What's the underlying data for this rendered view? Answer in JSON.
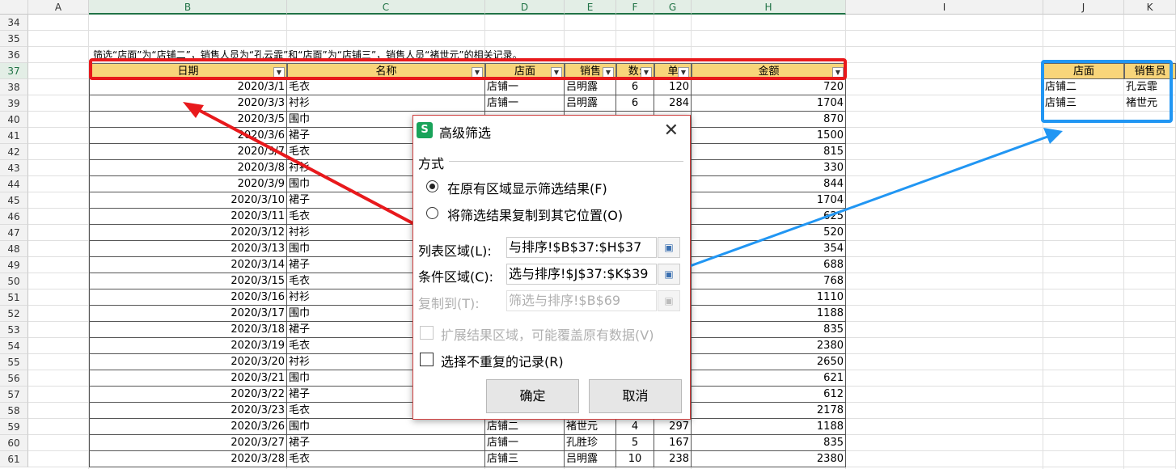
{
  "columns": [
    {
      "letter": "A"
    },
    {
      "letter": "B"
    },
    {
      "letter": "C"
    },
    {
      "letter": "D"
    },
    {
      "letter": "E"
    },
    {
      "letter": "F"
    },
    {
      "letter": "G"
    },
    {
      "letter": "H"
    },
    {
      "letter": "I"
    },
    {
      "letter": "J"
    },
    {
      "letter": "K"
    }
  ],
  "row_numbers": [
    "34",
    "35",
    "36",
    "37",
    "38",
    "39",
    "40",
    "41",
    "42",
    "43",
    "44",
    "45",
    "46",
    "47",
    "48",
    "49",
    "50",
    "51",
    "52",
    "53",
    "54",
    "55",
    "56",
    "57",
    "58",
    "59",
    "60",
    "61"
  ],
  "instruction": "筛选“店面”为“店铺二”，销售人员为“孔云霏”和“店面”为“店铺三”，销售人员“褚世元”的相关记录。",
  "table_headers": [
    "日期",
    "名称",
    "店面",
    "销售",
    "数:",
    "单",
    "金额"
  ],
  "table_rows": [
    [
      "2020/3/1",
      "毛衣",
      "店铺一",
      "吕明露",
      "6",
      "120",
      "720"
    ],
    [
      "2020/3/3",
      "衬衫",
      "店铺一",
      "吕明露",
      "6",
      "284",
      "1704"
    ],
    [
      "2020/3/5",
      "围巾",
      "",
      "",
      "",
      "",
      "870"
    ],
    [
      "2020/3/6",
      "裙子",
      "",
      "",
      "",
      "",
      "1500"
    ],
    [
      "2020/3/7",
      "毛衣",
      "",
      "",
      "",
      "",
      "815"
    ],
    [
      "2020/3/8",
      "衬衫",
      "",
      "",
      "",
      "",
      "330"
    ],
    [
      "2020/3/9",
      "围巾",
      "",
      "",
      "",
      "",
      "844"
    ],
    [
      "2020/3/10",
      "裙子",
      "",
      "",
      "",
      "",
      "1704"
    ],
    [
      "2020/3/11",
      "毛衣",
      "",
      "",
      "",
      "",
      "625"
    ],
    [
      "2020/3/12",
      "衬衫",
      "",
      "",
      "",
      "",
      "520"
    ],
    [
      "2020/3/13",
      "围巾",
      "",
      "",
      "",
      "",
      "354"
    ],
    [
      "2020/3/14",
      "裙子",
      "",
      "",
      "",
      "",
      "688"
    ],
    [
      "2020/3/15",
      "毛衣",
      "",
      "",
      "",
      "",
      "768"
    ],
    [
      "2020/3/16",
      "衬衫",
      "",
      "",
      "",
      "",
      "1110"
    ],
    [
      "2020/3/17",
      "围巾",
      "",
      "",
      "",
      "",
      "1188"
    ],
    [
      "2020/3/18",
      "裙子",
      "",
      "",
      "",
      "",
      "835"
    ],
    [
      "2020/3/19",
      "毛衣",
      "",
      "",
      "",
      "",
      "2380"
    ],
    [
      "2020/3/20",
      "衬衫",
      "",
      "",
      "",
      "",
      "2650"
    ],
    [
      "2020/3/21",
      "围巾",
      "",
      "",
      "",
      "",
      "621"
    ],
    [
      "2020/3/22",
      "裙子",
      "",
      "",
      "",
      "",
      "612"
    ],
    [
      "2020/3/23",
      "毛衣",
      "",
      "",
      "",
      "",
      "2178"
    ],
    [
      "2020/3/26",
      "围巾",
      "店铺二",
      "褚世元",
      "4",
      "297",
      "1188"
    ],
    [
      "2020/3/27",
      "裙子",
      "店铺一",
      "孔胜珍",
      "5",
      "167",
      "835"
    ],
    [
      "2020/3/28",
      "毛衣",
      "店铺三",
      "吕明露",
      "10",
      "238",
      "2380"
    ]
  ],
  "criteria": {
    "headers": [
      "店面",
      "销售员"
    ],
    "rows": [
      [
        "店铺二",
        "孔云霏"
      ],
      [
        "店铺三",
        "褚世元"
      ]
    ]
  },
  "dialog": {
    "logo": "S",
    "title": "高级筛选",
    "section_label": "方式",
    "radio_in_place": "在原有区域显示筛选结果(F)",
    "radio_copy": "将筛选结果复制到其它位置(O)",
    "list_range_label": "列表区域(L):",
    "list_range_value": "与排序!$B$37:$H$37",
    "criteria_range_label": "条件区域(C):",
    "criteria_range_value": "选与排序!$J$37:$K$39",
    "copy_to_label": "复制到(T):",
    "copy_to_value": "筛选与排序!$B$69",
    "expand_label": "扩展结果区域，可能覆盖原有数据(V)",
    "unique_label": "选择不重复的记录(R)",
    "ok_label": "确定",
    "cancel_label": "取消"
  },
  "colors": {
    "header_fill": "#f8d57a",
    "highlight_red": "#e8191c",
    "highlight_blue": "#2196f3",
    "excel_green": "#217346"
  }
}
